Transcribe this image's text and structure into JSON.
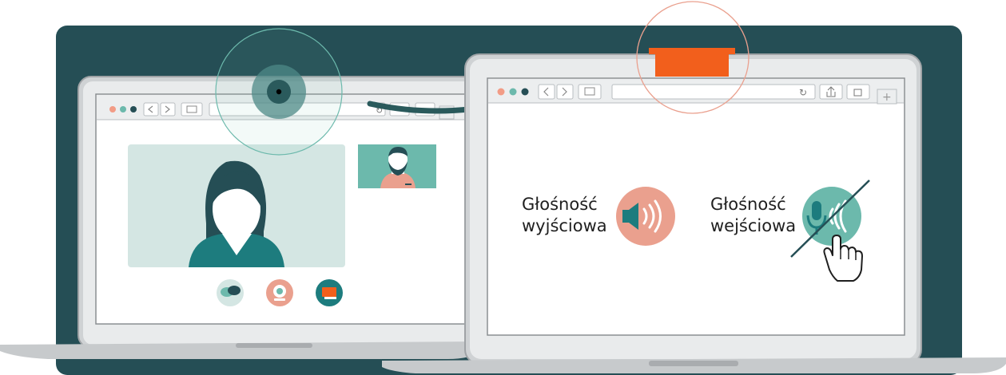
{
  "output_volume": {
    "line1": "Głośność",
    "line2": "wyjściowa",
    "icon": "speaker-icon",
    "color": "#eaa08e"
  },
  "input_volume": {
    "line1": "Głośność",
    "line2": "wejściowa",
    "icon": "microphone-icon",
    "color": "#6cb9ac",
    "muted": true
  },
  "call_controls": [
    {
      "icon": "chat-icon"
    },
    {
      "icon": "webcam-icon"
    },
    {
      "icon": "screen-share-icon"
    }
  ],
  "colors": {
    "background": "#254e55",
    "accent_orange": "#f25f1c",
    "teal": "#6cb9ac",
    "salmon": "#eaa08e"
  }
}
